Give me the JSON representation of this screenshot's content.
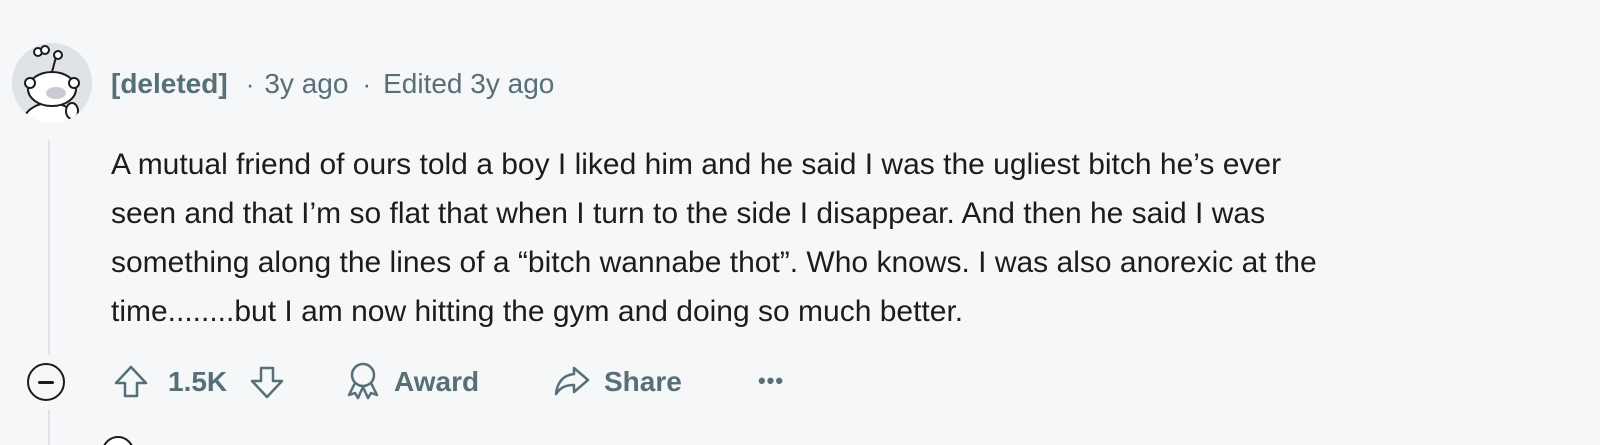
{
  "comment": {
    "author": "[deleted]",
    "separator": "·",
    "age": "3y ago",
    "edited": "Edited 3y ago",
    "body_lines": [
      "A mutual friend of ours told a boy I liked him and he said I was the ugliest bitch he’s ever",
      "seen and that I’m so flat that when I turn to the side I disappear. And then he said I was",
      "something along the lines of a “bitch wannabe thot”. Who knows. I was also anorexic at the",
      "time........but I am now hitting the gym and doing so much better."
    ]
  },
  "actions": {
    "score": "1.5K",
    "award_label": "Award",
    "share_label": "Share",
    "more_label": "•••"
  },
  "colors": {
    "background": "#f6f7f8",
    "text": "#1c1c1c",
    "meta": "#576f76",
    "thread_line": "#e0e2e5"
  },
  "icons": {
    "avatar": "snoo-avatar-icon",
    "collapse": "collapse-minus-icon",
    "upvote": "upvote-arrow-icon",
    "downvote": "downvote-arrow-icon",
    "award": "award-ribbon-icon",
    "share": "share-arrow-icon",
    "more": "more-dots-icon"
  }
}
